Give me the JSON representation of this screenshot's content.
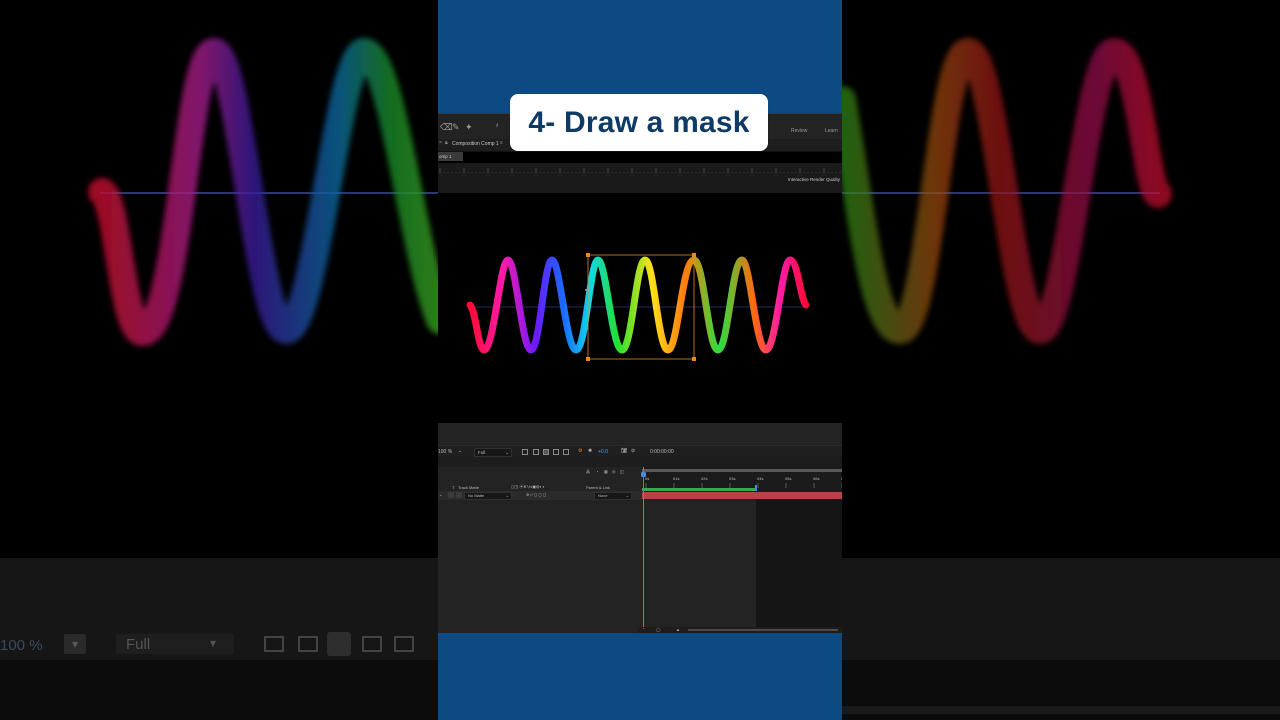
{
  "overlay": {
    "title": "4- Draw a mask"
  },
  "toolbar": {
    "review": "Review",
    "learn": "Learn",
    "pin": "ᵈ"
  },
  "composition": {
    "panel_label": "Composition Comp 1",
    "tab_label": "omp 1",
    "render_quality": "Interactive Render Quality"
  },
  "viewer_controls": {
    "zoom": "100 %",
    "resolution": "Full",
    "exposure": "+0.0",
    "timecode": "0:00:00:00"
  },
  "layers": {
    "track_matte_header": "Track Matte",
    "parent_header": "Parent & Link",
    "track_matte_value": "No Matte",
    "parent_value": "None"
  },
  "time_ruler": [
    "0s",
    "01s",
    "02s",
    "03s",
    "04s",
    "05s",
    "06s",
    "07s"
  ],
  "background": {
    "zoom": "100 %",
    "resolution": "Full"
  },
  "colors": {
    "column_blue": "#0e4a82",
    "pill_text": "#0e3a66",
    "mask_orange": "#e88a1e",
    "playhead_blue": "#3a8ee6",
    "work_area_green": "#3aa84a",
    "layer_bar_red": "#b8424a"
  }
}
